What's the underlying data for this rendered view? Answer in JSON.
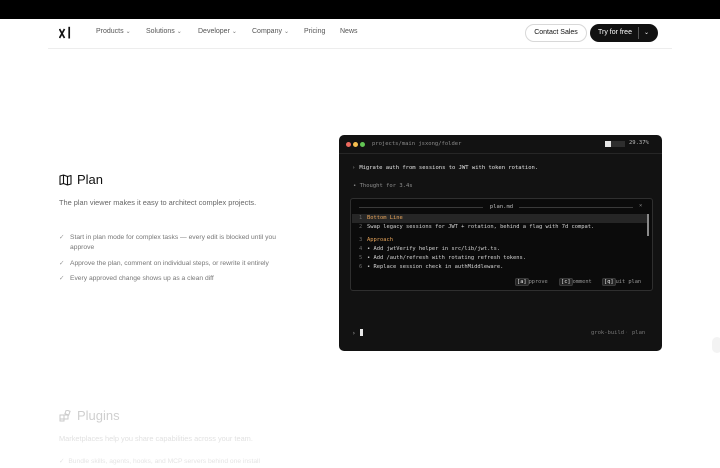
{
  "nav": {
    "items": [
      "Products",
      "Solutions",
      "Developer",
      "Company",
      "Pricing",
      "News"
    ],
    "contact_label": "Contact Sales",
    "try_label": "Try for free"
  },
  "plan": {
    "title": "Plan",
    "description": "The plan viewer makes it easy to architect complex projects.",
    "bullets": [
      "Start in plan mode for complex tasks — every edit is blocked until you approve",
      "Approve the plan, comment on individual steps, or rewrite it entirely",
      "Every approved change shows up as a clean diff"
    ]
  },
  "terminal": {
    "path": "projects/main jsxong/folder",
    "progress_percent": 29.37,
    "progress_label": "29.37%",
    "prompt": "Migrate auth from sessions to JWT with token rotation.",
    "thought": "Thought for 3.4s",
    "plan_viewer": {
      "title": "plan.md",
      "close": "×",
      "lines": [
        {
          "num": "1",
          "text": "Bottom Line"
        },
        {
          "num": "2",
          "text": "Swap legacy sessions for JWT + rotation, behind a flag with 7d compat."
        },
        {
          "num": "3",
          "text": "Approach"
        },
        {
          "num": "4",
          "text": "• Add jwtVerify helper in src/lib/jwt.ts."
        },
        {
          "num": "5",
          "text": "• Add /auth/refresh with rotating refresh tokens."
        },
        {
          "num": "6",
          "text": "• Replace session check in authMiddleware."
        }
      ],
      "shortcuts": [
        {
          "key": "a",
          "label": "pprove"
        },
        {
          "key": "c",
          "label": "omment"
        },
        {
          "key": "q",
          "label": "uit plan"
        }
      ]
    },
    "input_caret": "›",
    "mode_agent": "grok-build",
    "mode_plan": "plan"
  },
  "plugins": {
    "title": "Plugins",
    "description": "Marketplaces help you share capabilities across your team.",
    "bullet": "Bundle skills, agents, hooks, and MCP servers behind one install"
  },
  "colors": {
    "accent_orange": "#e8a55a",
    "terminal_bg": "#121212",
    "dot_red": "#ee6a5f",
    "dot_yellow": "#f5be4f",
    "dot_green": "#62c554"
  }
}
